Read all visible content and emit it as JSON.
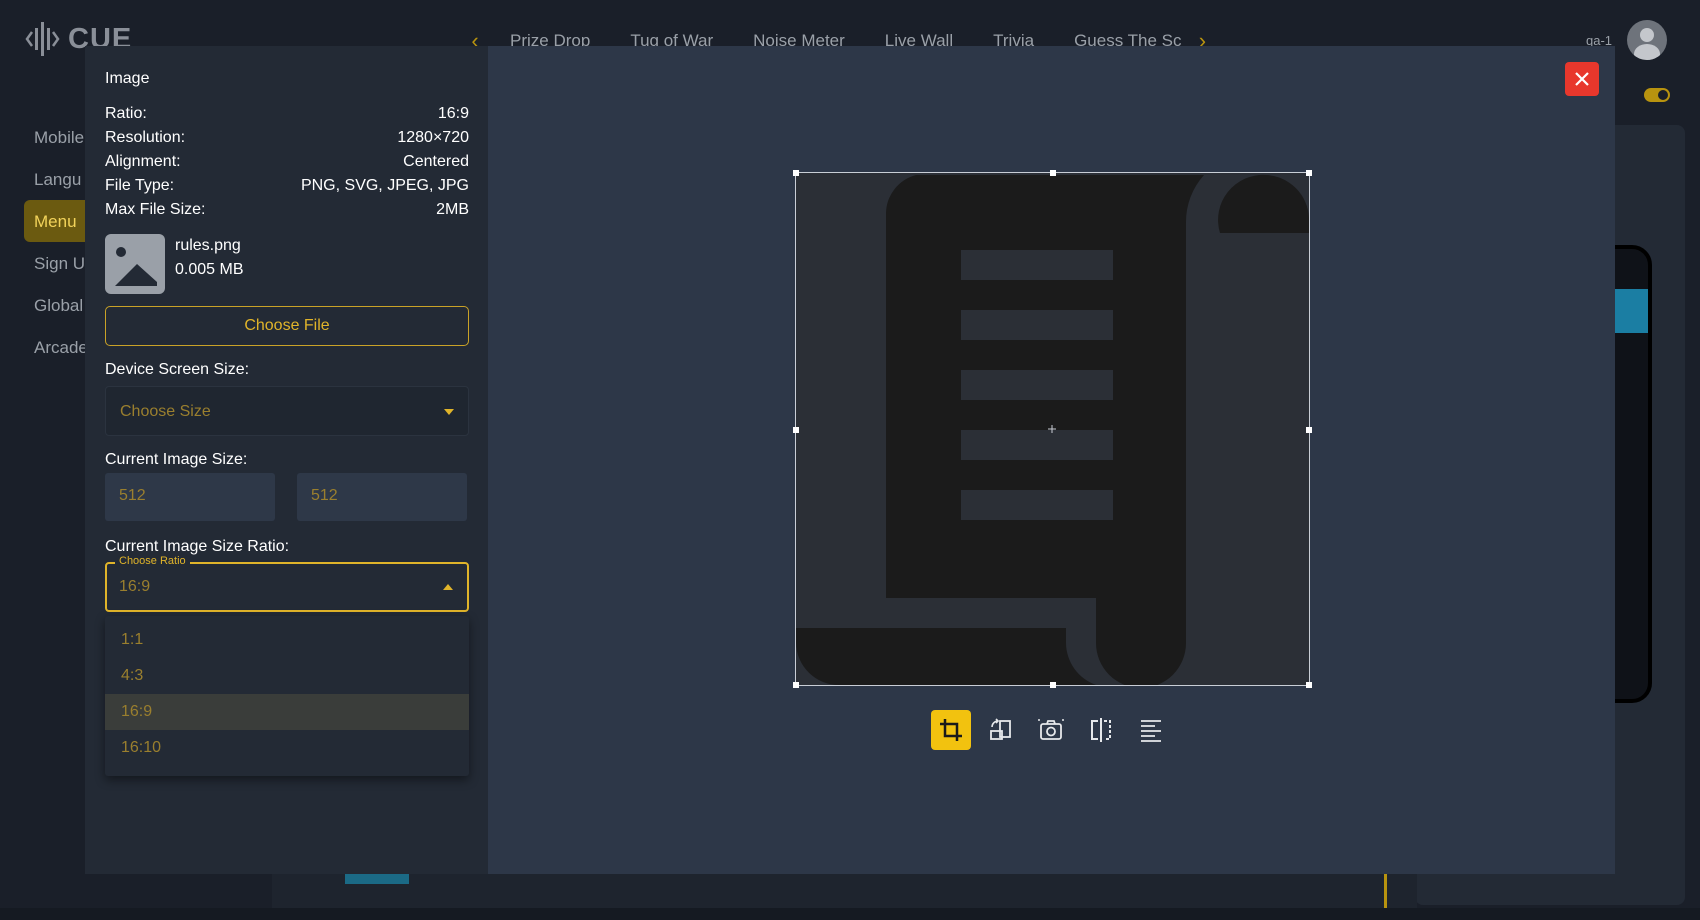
{
  "app": {
    "logo_text": "CUE",
    "nav": [
      "Prize Drop",
      "Tug of War",
      "Noise Meter",
      "Live Wall",
      "Trivia",
      "Guess The Sc"
    ],
    "user_name": "qa-1",
    "sidebar": [
      "Mobile",
      "Langu",
      "Menu",
      "Sign U",
      "Global",
      "Arcade"
    ]
  },
  "modal": {
    "title": "Image",
    "info": [
      {
        "label": "Ratio:",
        "value": "16:9"
      },
      {
        "label": "Resolution:",
        "value": "1280×720"
      },
      {
        "label": "Alignment:",
        "value": "Centered"
      },
      {
        "label": "File Type:",
        "value": "PNG, SVG, JPEG, JPG"
      },
      {
        "label": "Max File Size:",
        "value": "2MB"
      }
    ],
    "file": {
      "name": "rules.png",
      "size": "0.005 MB"
    },
    "choose_file": "Choose File",
    "device_size_label": "Device Screen Size:",
    "device_size_placeholder": "Choose Size",
    "image_size_label": "Current Image Size:",
    "width": "512",
    "height": "512",
    "ratio_label": "Current Image Size Ratio:",
    "ratio_legend": "Choose Ratio",
    "ratio_value": "16:9",
    "ratio_options": [
      "1:1",
      "4:3",
      "16:9",
      "16:10"
    ],
    "selected_ratio_index": 2
  },
  "icons": {
    "close": "close-icon",
    "tools": [
      "crop-icon",
      "rotate-icon",
      "camera-flip-icon",
      "flip-horizontal-icon",
      "align-icon"
    ]
  },
  "colors": {
    "accent": "#f2c20f",
    "close": "#e8372c",
    "panel": "#232a35",
    "canvas": "#2d3748"
  }
}
